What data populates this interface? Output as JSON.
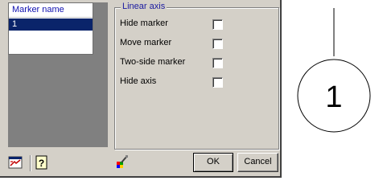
{
  "marker_list": {
    "header": "Marker name",
    "rows": [
      "1"
    ],
    "selected_index": 0
  },
  "options_group": {
    "legend": "Linear axis",
    "options": [
      {
        "label": "Hide marker",
        "checked": false
      },
      {
        "label": "Move marker",
        "checked": false
      },
      {
        "label": "Two-side marker",
        "checked": false
      },
      {
        "label": "Hide axis",
        "checked": false
      }
    ]
  },
  "toolbar": {
    "icons": [
      "marker-settings-icon",
      "help-icon",
      "color-picker-icon"
    ]
  },
  "buttons": {
    "ok_label": "OK",
    "cancel_label": "Cancel"
  },
  "preview": {
    "marker_label": "1"
  },
  "colors": {
    "dialog_bg": "#d4d0c8",
    "selection": "#0a246a",
    "header_text": "#1010b0"
  }
}
